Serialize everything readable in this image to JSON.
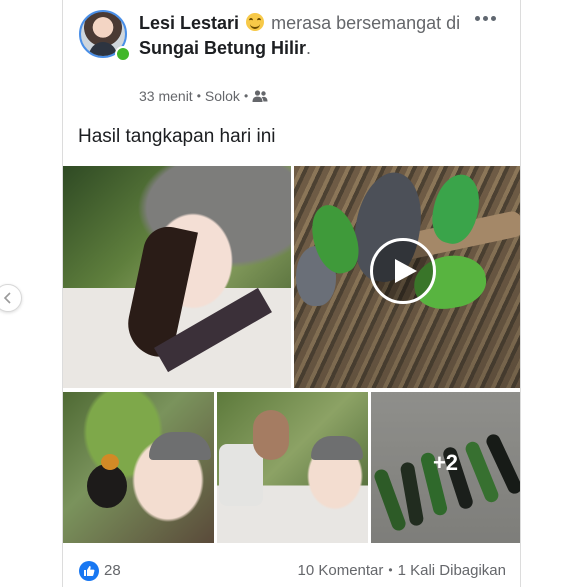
{
  "post": {
    "author": "Lesi Lestari",
    "feeling_icon": "grinning-emoji",
    "feeling_text": "merasa bersemangat di",
    "location": "Sungai Betung Hilir",
    "location_suffix": ".",
    "time": "33 menit",
    "place": "Solok",
    "audience_icon": "friends-icon",
    "caption": "Hasil tangkapan hari ini",
    "more_photos": "+2",
    "likes": "28",
    "comments": "10 Komentar",
    "shares": "1 Kali Dibagikan"
  },
  "colors": {
    "accent_blue": "#1877f2",
    "online_green": "#42b72a",
    "muted_text": "#65676b"
  }
}
